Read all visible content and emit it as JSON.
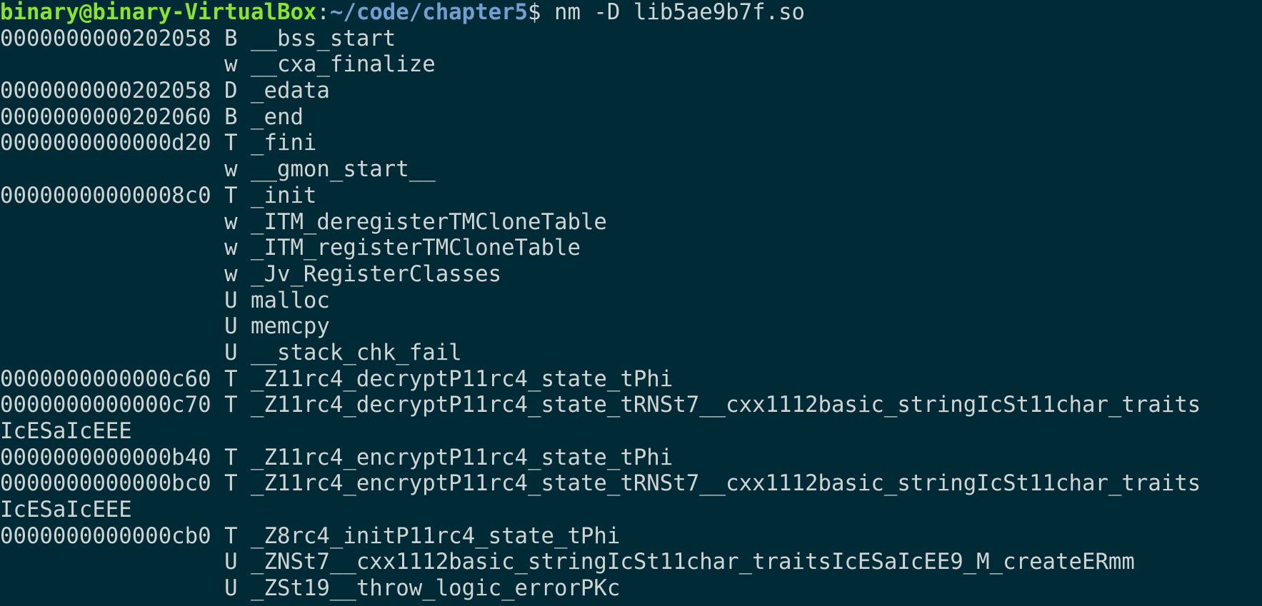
{
  "terminal": {
    "prompt": {
      "user_host": "binary@binary-VirtualBox",
      "separator": ":",
      "path": "~/code/chapter5",
      "dollar": "$ ",
      "command": "nm -D lib5ae9b7f.so"
    },
    "colors": {
      "background": "#002b36",
      "text": "#d0d4d4",
      "user_host": "#8ae234",
      "path": "#729fcf"
    },
    "lines": [
      "0000000000202058 B __bss_start",
      "                 w __cxa_finalize",
      "0000000000202058 D _edata",
      "0000000000202060 B _end",
      "0000000000000d20 T _fini",
      "                 w __gmon_start__",
      "00000000000008c0 T _init",
      "                 w _ITM_deregisterTMCloneTable",
      "                 w _ITM_registerTMCloneTable",
      "                 w _Jv_RegisterClasses",
      "                 U malloc",
      "                 U memcpy",
      "                 U __stack_chk_fail",
      "0000000000000c60 T _Z11rc4_decryptP11rc4_state_tPhi",
      "0000000000000c70 T _Z11rc4_decryptP11rc4_state_tRNSt7__cxx1112basic_stringIcSt11char_traits",
      "IcESaIcEEE",
      "0000000000000b40 T _Z11rc4_encryptP11rc4_state_tPhi",
      "0000000000000bc0 T _Z11rc4_encryptP11rc4_state_tRNSt7__cxx1112basic_stringIcSt11char_traits",
      "IcESaIcEEE",
      "0000000000000cb0 T _Z8rc4_initP11rc4_state_tPhi",
      "                 U _ZNSt7__cxx1112basic_stringIcSt11char_traitsIcESaIcEE9_M_createERmm",
      "                 U _ZSt19__throw_logic_errorPKc"
    ]
  }
}
